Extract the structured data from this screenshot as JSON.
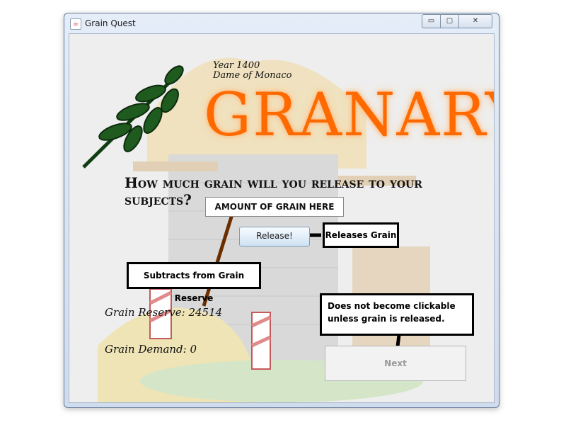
{
  "window": {
    "title": "Grain Quest",
    "controls": {
      "minimize": "▭",
      "maximize": "▢",
      "close": "✕"
    }
  },
  "header": {
    "year": "Year 1400",
    "ruler": "Dame of Monaco",
    "title": "GRANARY"
  },
  "question": "How much grain will you release to your subjects?",
  "grain_input": {
    "value": "AMOUNT OF GRAIN HERE"
  },
  "release_button": {
    "label": "Release!"
  },
  "callouts": {
    "release": "Releases Grain",
    "subtract": "Subtracts from Grain Reserve",
    "next": "Does not become clickable unless grain is released."
  },
  "stats": {
    "reserve_label": "Grain Reserve:",
    "reserve_value": "24514",
    "demand_label": "Grain Demand:",
    "demand_value": "0"
  },
  "next_button": {
    "label": "Next",
    "enabled": false
  },
  "colors": {
    "title_orange": "#ff6a00",
    "wheat_green": "#1f5a1f"
  },
  "icons": [
    "app-icon",
    "wheat-icon",
    "minimize-icon",
    "maximize-icon",
    "close-icon"
  ]
}
